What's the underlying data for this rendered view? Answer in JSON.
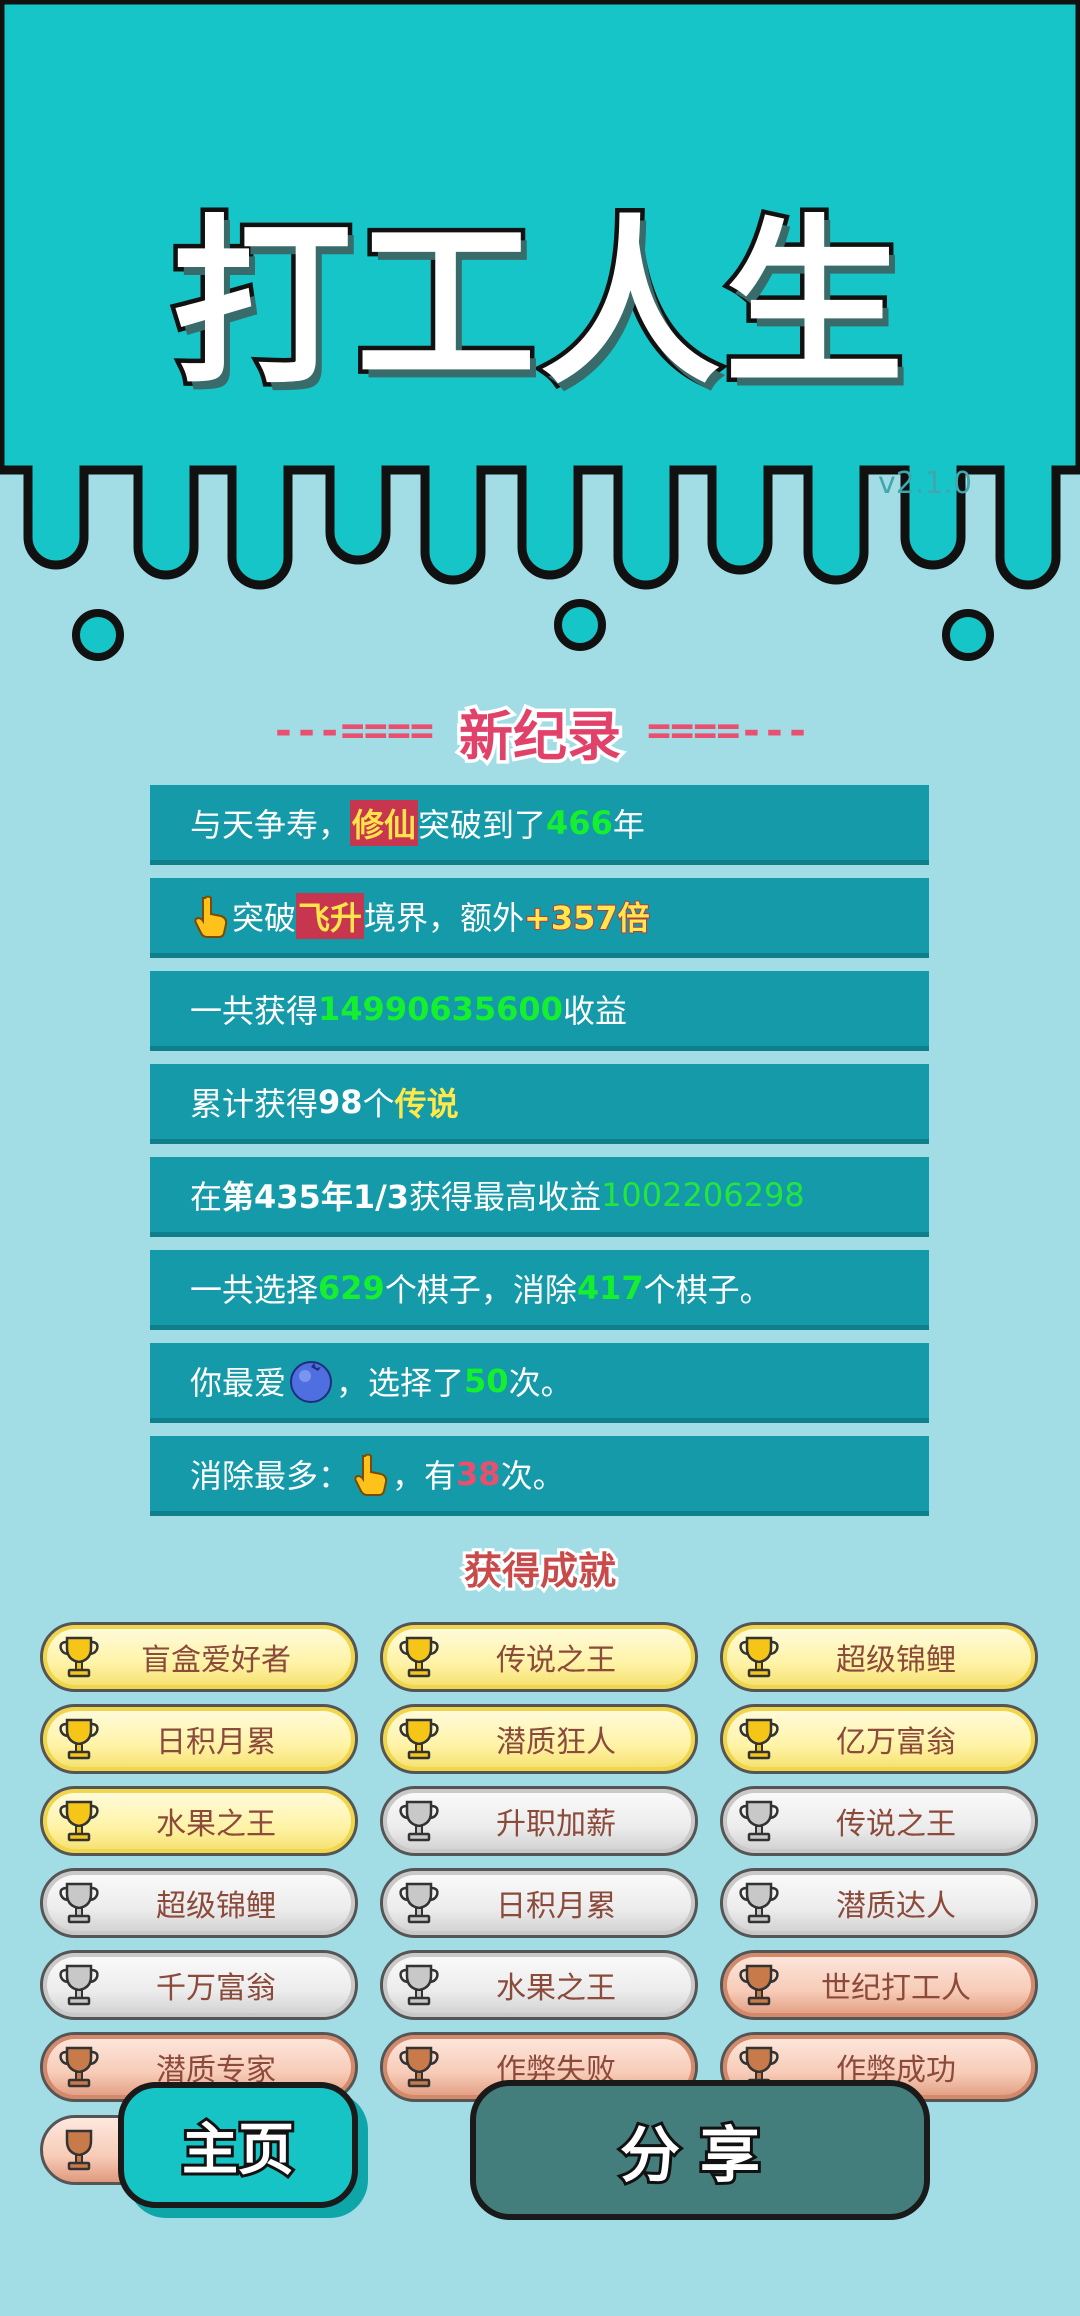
{
  "app": {
    "title": "打工人生",
    "version": "v2.1.0",
    "colors": {
      "teal": "#16c5c8",
      "panel": "#149aa8",
      "background": "#a2dde6",
      "highlight_green": "#15f02e",
      "highlight_pink": "#ea4f6f"
    }
  },
  "record": {
    "heading": "新纪录",
    "deco_left": "---====",
    "deco_right": "====---",
    "rows": [
      {
        "a": "与天争寿，",
        "b": "修仙",
        "c": "突破到了",
        "d": "466",
        "e": "年"
      },
      {
        "icon": "pointing-hand-icon",
        "a": "突破",
        "b": "飞升",
        "c": "境界，额外",
        "d": "+357倍"
      },
      {
        "a": "一共获得",
        "b": "14990635600",
        "c": "收益"
      },
      {
        "a": "累计获得",
        "b": "98",
        "c": "个",
        "d": "传说"
      },
      {
        "a": "在 ",
        "b": "第435年1/3",
        "c": " 获得最高收益",
        "d": "1002206298"
      },
      {
        "a": "一共选择",
        "b": "629",
        "c": "个棋子，消除",
        "d": "417",
        "e": "个棋子。"
      },
      {
        "a": "你最爱",
        "icon": "blueberry-icon",
        "b": "，选择了",
        "c": "50",
        "d": "次。"
      },
      {
        "a": "消除最多：",
        "icon": "pointing-hand-icon",
        "b": "，有",
        "c": "38",
        "d": "次。"
      }
    ]
  },
  "achievements": {
    "title": "获得成就",
    "items": [
      {
        "label": "盲盒爱好者",
        "tier": "gold"
      },
      {
        "label": "传说之王",
        "tier": "gold"
      },
      {
        "label": "超级锦鲤",
        "tier": "gold"
      },
      {
        "label": "日积月累",
        "tier": "gold"
      },
      {
        "label": "潜质狂人",
        "tier": "gold"
      },
      {
        "label": "亿万富翁",
        "tier": "gold"
      },
      {
        "label": "水果之王",
        "tier": "gold"
      },
      {
        "label": "升职加薪",
        "tier": "silver"
      },
      {
        "label": "传说之王",
        "tier": "silver"
      },
      {
        "label": "超级锦鲤",
        "tier": "silver"
      },
      {
        "label": "日积月累",
        "tier": "silver"
      },
      {
        "label": "潜质达人",
        "tier": "silver"
      },
      {
        "label": "千万富翁",
        "tier": "silver"
      },
      {
        "label": "水果之王",
        "tier": "silver"
      },
      {
        "label": "世纪打工人",
        "tier": "bronze"
      },
      {
        "label": "潜质专家",
        "tier": "bronze"
      },
      {
        "label": "作弊失败",
        "tier": "bronze"
      },
      {
        "label": "作弊成功",
        "tier": "bronze"
      }
    ]
  },
  "buttons": {
    "home": "主页",
    "share": "分享"
  }
}
